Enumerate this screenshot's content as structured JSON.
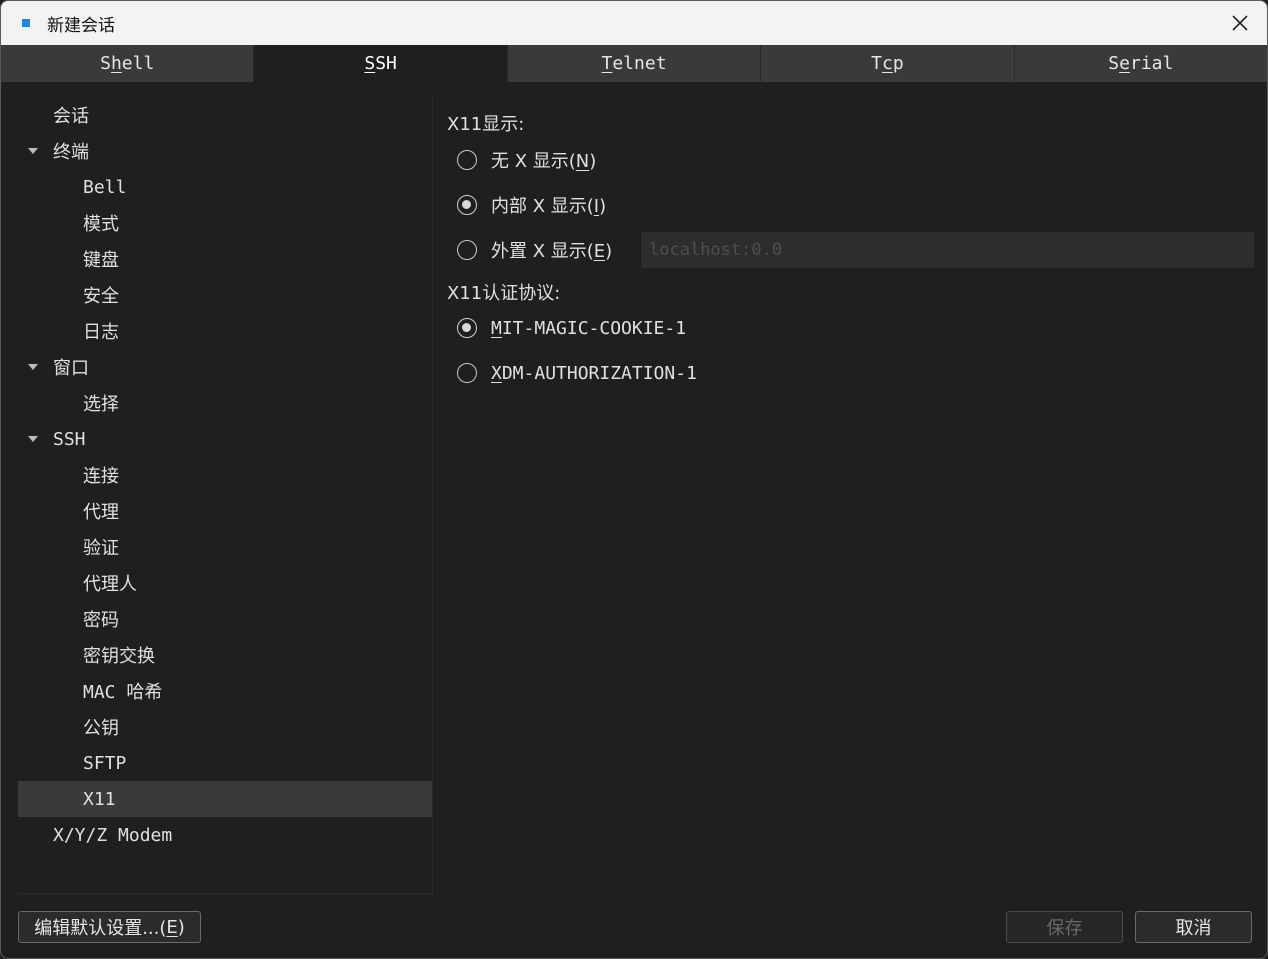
{
  "window": {
    "title": "新建会话",
    "close_glyph": "✕",
    "accent_color": "#1e88e5"
  },
  "tabs": [
    {
      "pre": "S",
      "key": "h",
      "post": "ell",
      "active": false
    },
    {
      "pre": "",
      "key": "S",
      "post": "SH",
      "active": true
    },
    {
      "pre": "",
      "key": "T",
      "post": "elnet",
      "active": false
    },
    {
      "pre": "T",
      "key": "c",
      "post": "p",
      "active": false
    },
    {
      "pre": "S",
      "key": "e",
      "post": "rial",
      "active": false
    }
  ],
  "tree": [
    {
      "label": "会话",
      "level": 0,
      "expanded": null
    },
    {
      "label": "终端",
      "level": 0,
      "expanded": true
    },
    {
      "label": "Bell",
      "level": 1
    },
    {
      "label": "模式",
      "level": 1
    },
    {
      "label": "键盘",
      "level": 1
    },
    {
      "label": "安全",
      "level": 1
    },
    {
      "label": "日志",
      "level": 1
    },
    {
      "label": "窗口",
      "level": 0,
      "expanded": true
    },
    {
      "label": "选择",
      "level": 1
    },
    {
      "label": "SSH",
      "level": 0,
      "expanded": true
    },
    {
      "label": "连接",
      "level": 1
    },
    {
      "label": "代理",
      "level": 1
    },
    {
      "label": "验证",
      "level": 1
    },
    {
      "label": "代理人",
      "level": 1
    },
    {
      "label": "密码",
      "level": 1
    },
    {
      "label": "密钥交换",
      "level": 1
    },
    {
      "label": "MAC 哈希",
      "level": 1
    },
    {
      "label": "公钥",
      "level": 1
    },
    {
      "label": "SFTP",
      "level": 1
    },
    {
      "label": "X11",
      "level": 1,
      "selected": true
    },
    {
      "label": "X/Y/Z Modem",
      "level": 0,
      "expanded": null
    }
  ],
  "x11": {
    "display_label": "X11显示:",
    "display_options": [
      {
        "pre": "无 X 显示(",
        "key": "N",
        "post": ")",
        "checked": false
      },
      {
        "pre": "内部 X 显示(",
        "key": "I",
        "post": ")",
        "checked": true
      },
      {
        "pre": "外置 X 显示(",
        "key": "E",
        "post": ")",
        "checked": false
      }
    ],
    "display_placeholder": "localhost:0.0",
    "display_value": "",
    "auth_label": "X11认证协议:",
    "auth_options": [
      {
        "pre": "",
        "key": "M",
        "post": "IT-MAGIC-COOKIE-1",
        "checked": true
      },
      {
        "pre": "",
        "key": "X",
        "post": "DM-AUTHORIZATION-1",
        "checked": false
      }
    ]
  },
  "buttons": {
    "default_pre": "编辑默认设置...(",
    "default_key": "E",
    "default_post": ")",
    "save": "保存",
    "cancel": "取消"
  }
}
